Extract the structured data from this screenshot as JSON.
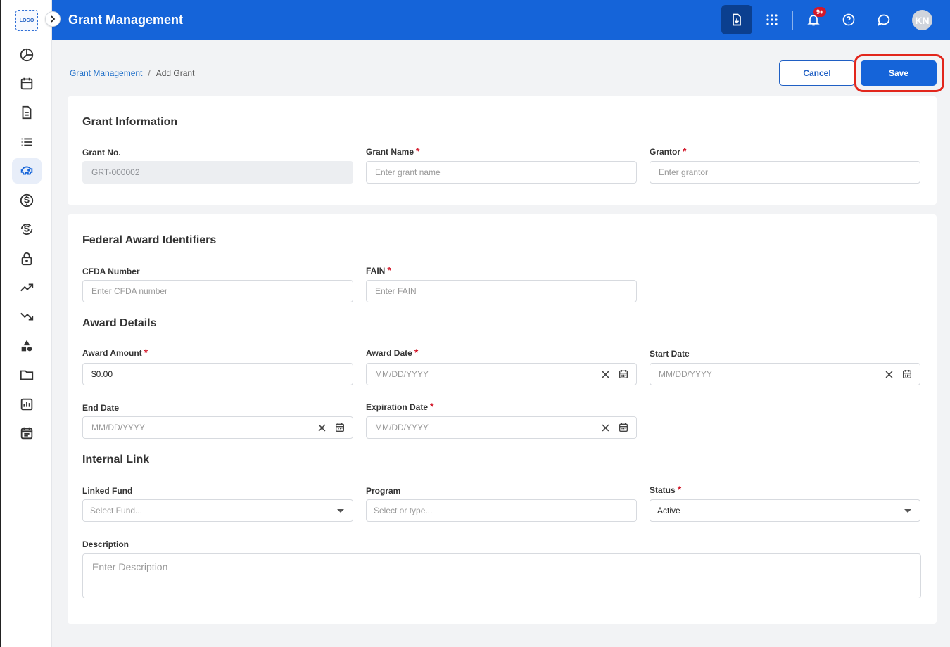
{
  "sidebar": {
    "logo": "LOGO",
    "icons": [
      "pie-chart-icon",
      "calendar-icon",
      "document-icon",
      "list-icon",
      "piggy-bank-icon",
      "dollar-circle-icon",
      "refund-icon",
      "lock-icon",
      "trend-up-icon",
      "trend-down-icon",
      "shapes-icon",
      "folder-icon",
      "bar-report-icon",
      "schedule-icon"
    ]
  },
  "header": {
    "title": "Grant Management",
    "notifications_badge": "9+",
    "avatar_initials": "KN",
    "brand_color": "#1564d9"
  },
  "breadcrumb": {
    "parent": "Grant Management",
    "separator": "/",
    "current": "Add Grant"
  },
  "actions": {
    "cancel_label": "Cancel",
    "save_label": "Save"
  },
  "grant_info": {
    "title": "Grant Information",
    "grant_no_label": "Grant No.",
    "grant_no_value": "GRT-000002",
    "grant_name_label": "Grant Name",
    "grant_name_placeholder": "Enter grant name",
    "grantor_label": "Grantor",
    "grantor_placeholder": "Enter grantor"
  },
  "federal": {
    "title": "Federal Award Identifiers",
    "cfda_label": "CFDA Number",
    "cfda_placeholder": "Enter CFDA number",
    "fain_label": "FAIN",
    "fain_placeholder": "Enter FAIN"
  },
  "award": {
    "title": "Award Details",
    "amount_label": "Award Amount",
    "amount_value": "$0.00",
    "award_date_label": "Award Date",
    "start_date_label": "Start Date",
    "end_date_label": "End Date",
    "expiration_date_label": "Expiration Date",
    "date_placeholder": "MM/DD/YYYY"
  },
  "internal": {
    "title": "Internal Link",
    "fund_label": "Linked Fund",
    "fund_placeholder": "Select Fund...",
    "program_label": "Program",
    "program_placeholder": "Select or type...",
    "status_label": "Status",
    "status_value": "Active",
    "description_label": "Description",
    "description_placeholder": "Enter Description"
  },
  "required_mark": "*"
}
